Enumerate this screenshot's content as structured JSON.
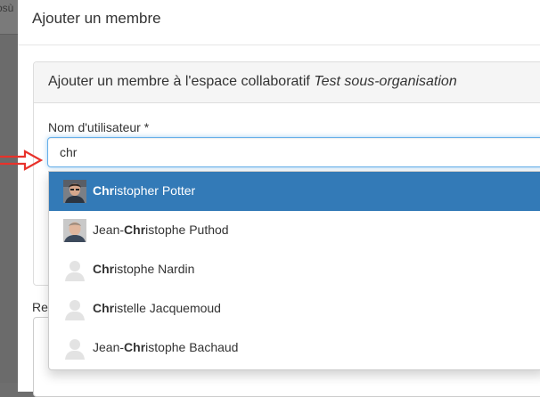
{
  "backdrop": {
    "partial_text": "osù"
  },
  "modal": {
    "title": "Ajouter un membre",
    "panel": {
      "title_prefix": "Ajouter un membre à l'espace collaboratif ",
      "title_space": "Test sous-organisation",
      "username_label": "Nom d'utilisateur *",
      "username_value": "chr"
    },
    "second_section_label": "Re"
  },
  "autocomplete": {
    "query": "chr",
    "items": [
      {
        "before": "",
        "match": "Chr",
        "after": "istopher Potter",
        "avatar": "photo-avatar-1",
        "selected": true
      },
      {
        "before": "Jean-",
        "match": "Chr",
        "after": "istophe Puthod",
        "avatar": "photo-avatar-2",
        "selected": false
      },
      {
        "before": "",
        "match": "Chr",
        "after": "istophe Nardin",
        "avatar": "default-avatar",
        "selected": false
      },
      {
        "before": "",
        "match": "Chr",
        "after": "istelle Jacquemoud",
        "avatar": "default-avatar",
        "selected": false
      },
      {
        "before": "Jean-",
        "match": "Chr",
        "after": "istophe Bachaud",
        "avatar": "default-avatar",
        "selected": false
      }
    ]
  },
  "colors": {
    "selected_bg": "#337ab7",
    "focus_border": "#66afe9",
    "pointer_arrow": "#e8322b"
  }
}
